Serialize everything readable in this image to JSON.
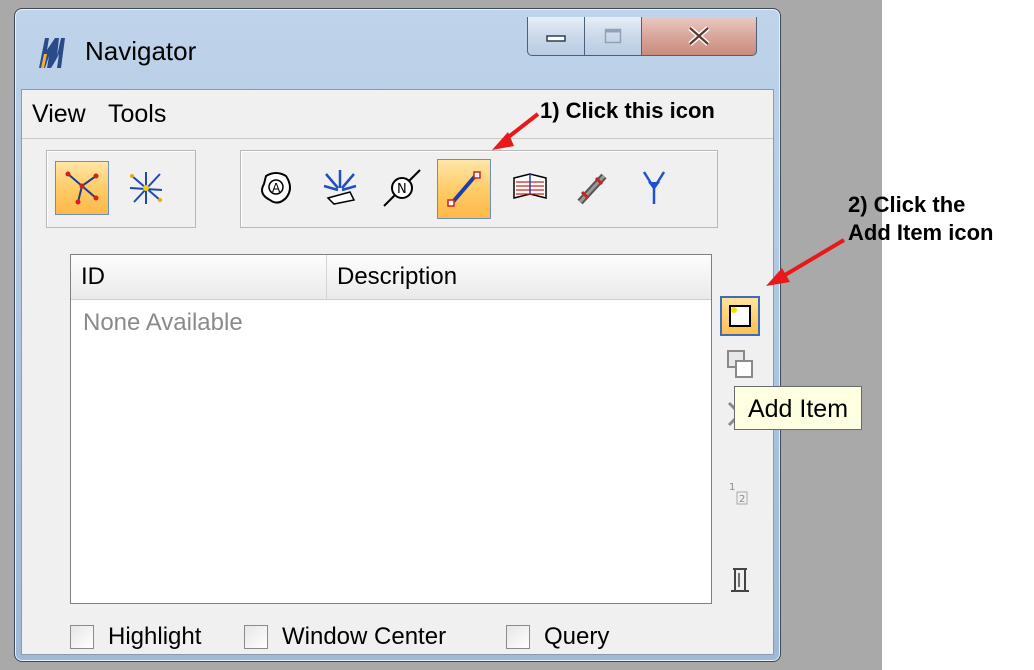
{
  "window": {
    "title": "Navigator",
    "minimize_icon": "minimize-icon",
    "maximize_icon": "maximize-icon",
    "close_icon": "close-icon"
  },
  "menu": [
    "View",
    "Tools"
  ],
  "mode_buttons": [
    {
      "icon": "network-graph-icon",
      "active": true
    },
    {
      "icon": "scatter-star-icon",
      "active": false
    }
  ],
  "tool_buttons": [
    {
      "icon": "area-shape-icon",
      "active": false
    },
    {
      "icon": "arrows-converge-icon",
      "active": false
    },
    {
      "icon": "node-circle-icon",
      "active": false
    },
    {
      "icon": "line-segment-icon",
      "active": true
    },
    {
      "icon": "striped-book-icon",
      "active": false
    },
    {
      "icon": "link-element-icon",
      "active": false
    },
    {
      "icon": "fork-arrow-icon",
      "active": false
    }
  ],
  "list": {
    "columns": [
      "ID",
      "Description"
    ],
    "empty_text": "None Available"
  },
  "side_buttons": [
    {
      "icon": "add-item-icon",
      "active": true
    },
    {
      "icon": "copy-item-icon",
      "active": false
    },
    {
      "icon": "delete-item-icon",
      "active": false
    },
    {
      "icon": "renumber-icon",
      "active": false
    },
    {
      "icon": "properties-icon",
      "active": false
    }
  ],
  "tooltip": "Add Item",
  "checkboxes": [
    "Highlight",
    "Window Center",
    "Query"
  ],
  "annotations": {
    "step1": "1) Click this icon",
    "step2_line1": "2) Click the",
    "step2_line2": "Add Item icon"
  },
  "colors": {
    "arrow": "#e8191a",
    "active_button": "#ffcc66",
    "tooltip_bg": "#ffffe1"
  }
}
